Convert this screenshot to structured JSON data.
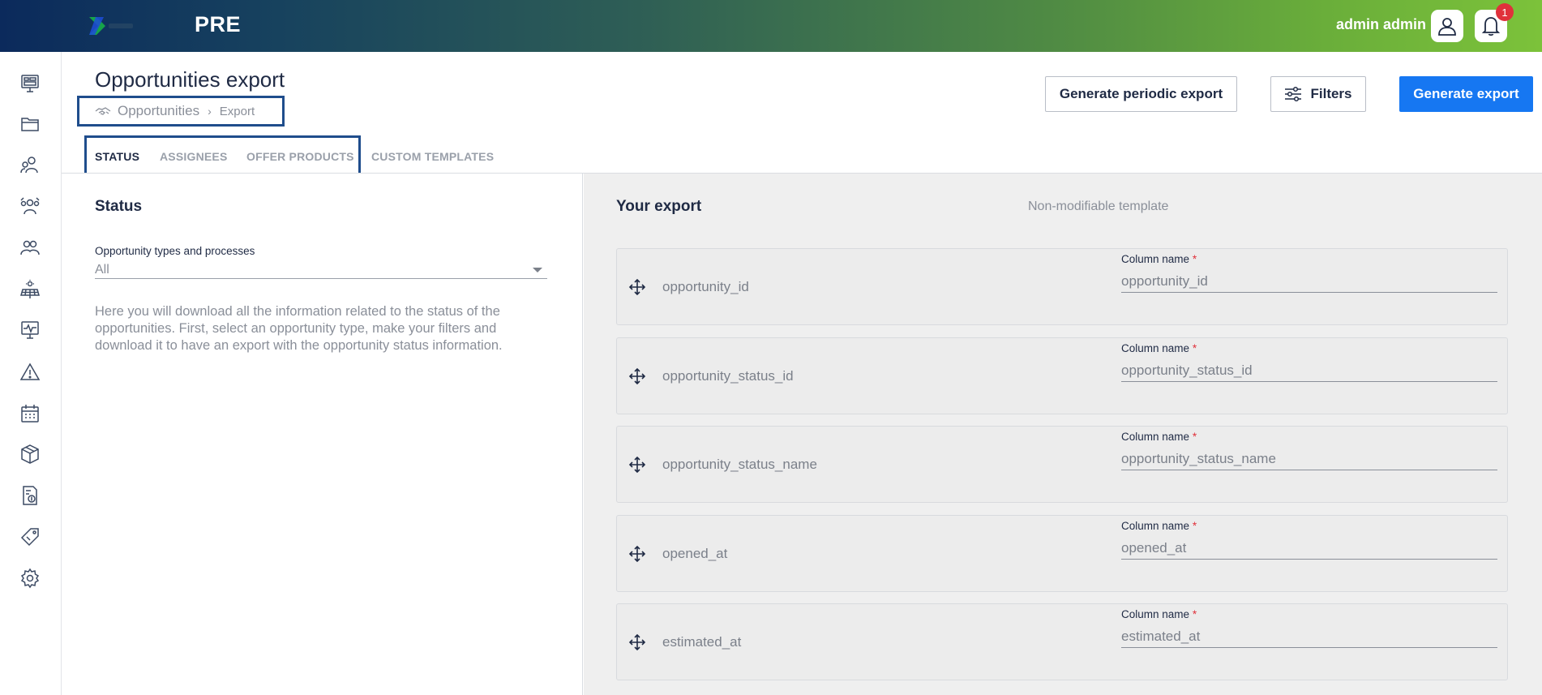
{
  "header": {
    "env_label": "PRE",
    "user_name": "admin admin",
    "notification_count": "1"
  },
  "sidebar": {
    "items": [
      {
        "icon": "dashboard-icon"
      },
      {
        "icon": "folder-icon"
      },
      {
        "icon": "contacts-icon"
      },
      {
        "icon": "team-icon"
      },
      {
        "icon": "groups-icon"
      },
      {
        "icon": "solar-panel-icon"
      },
      {
        "icon": "monitor-icon"
      },
      {
        "icon": "warning-icon"
      },
      {
        "icon": "calendar-icon"
      },
      {
        "icon": "package-icon"
      },
      {
        "icon": "invoice-icon"
      },
      {
        "icon": "tag-icon"
      },
      {
        "icon": "settings-icon"
      }
    ]
  },
  "page": {
    "title": "Opportunities export",
    "breadcrumb": [
      "Opportunities",
      "Export"
    ],
    "breadcrumb_sep": "›"
  },
  "actions": {
    "periodic_label": "Generate periodic export",
    "filters_label": "Filters",
    "generate_label": "Generate export"
  },
  "tabs": [
    {
      "label": "STATUS",
      "active": true
    },
    {
      "label": "ASSIGNEES",
      "active": false
    },
    {
      "label": "OFFER PRODUCTS",
      "active": false
    },
    {
      "label": "CUSTOM TEMPLATES",
      "active": false
    }
  ],
  "left": {
    "section_title": "Status",
    "field_label": "Opportunity types and processes",
    "field_value": "All",
    "description": "Here you will download all the information related to the status of the opportunities. First, select an opportunity type, make your filters and download it to have an export with the opportunity status information."
  },
  "right": {
    "title": "Your export",
    "template_note": "Non-modifiable template",
    "column_label": "Column name",
    "required_mark": "*",
    "rows": [
      {
        "field": "opportunity_id",
        "column": "opportunity_id"
      },
      {
        "field": "opportunity_status_id",
        "column": "opportunity_status_id"
      },
      {
        "field": "opportunity_status_name",
        "column": "opportunity_status_name"
      },
      {
        "field": "opened_at",
        "column": "opened_at"
      },
      {
        "field": "estimated_at",
        "column": "estimated_at"
      }
    ]
  },
  "colors": {
    "primary": "#1677f2",
    "highlight_border": "#1f4d8c",
    "required": "#e0313b"
  }
}
